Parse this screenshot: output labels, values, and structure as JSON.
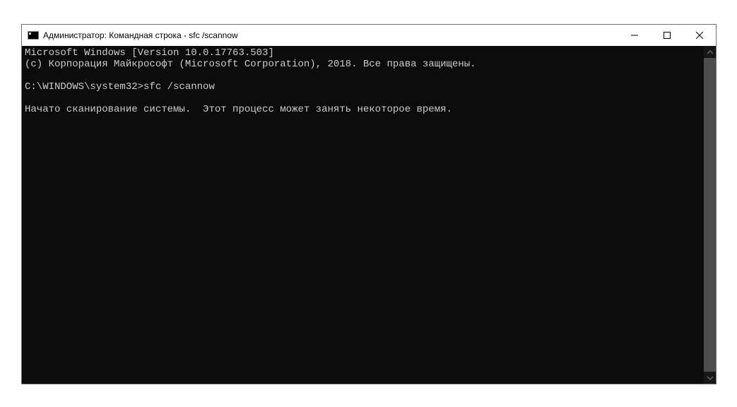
{
  "window": {
    "title": "Администратор: Командная строка - sfc  /scannow"
  },
  "terminal": {
    "line1": "Microsoft Windows [Version 10.0.17763.503]",
    "line2": "(c) Корпорация Майкрософт (Microsoft Corporation), 2018. Все права защищены.",
    "blank1": "",
    "prompt_line": "C:\\WINDOWS\\system32>sfc /scannow",
    "blank2": "",
    "status_line": "Начато сканирование системы.  Этот процесс может занять некоторое время."
  }
}
